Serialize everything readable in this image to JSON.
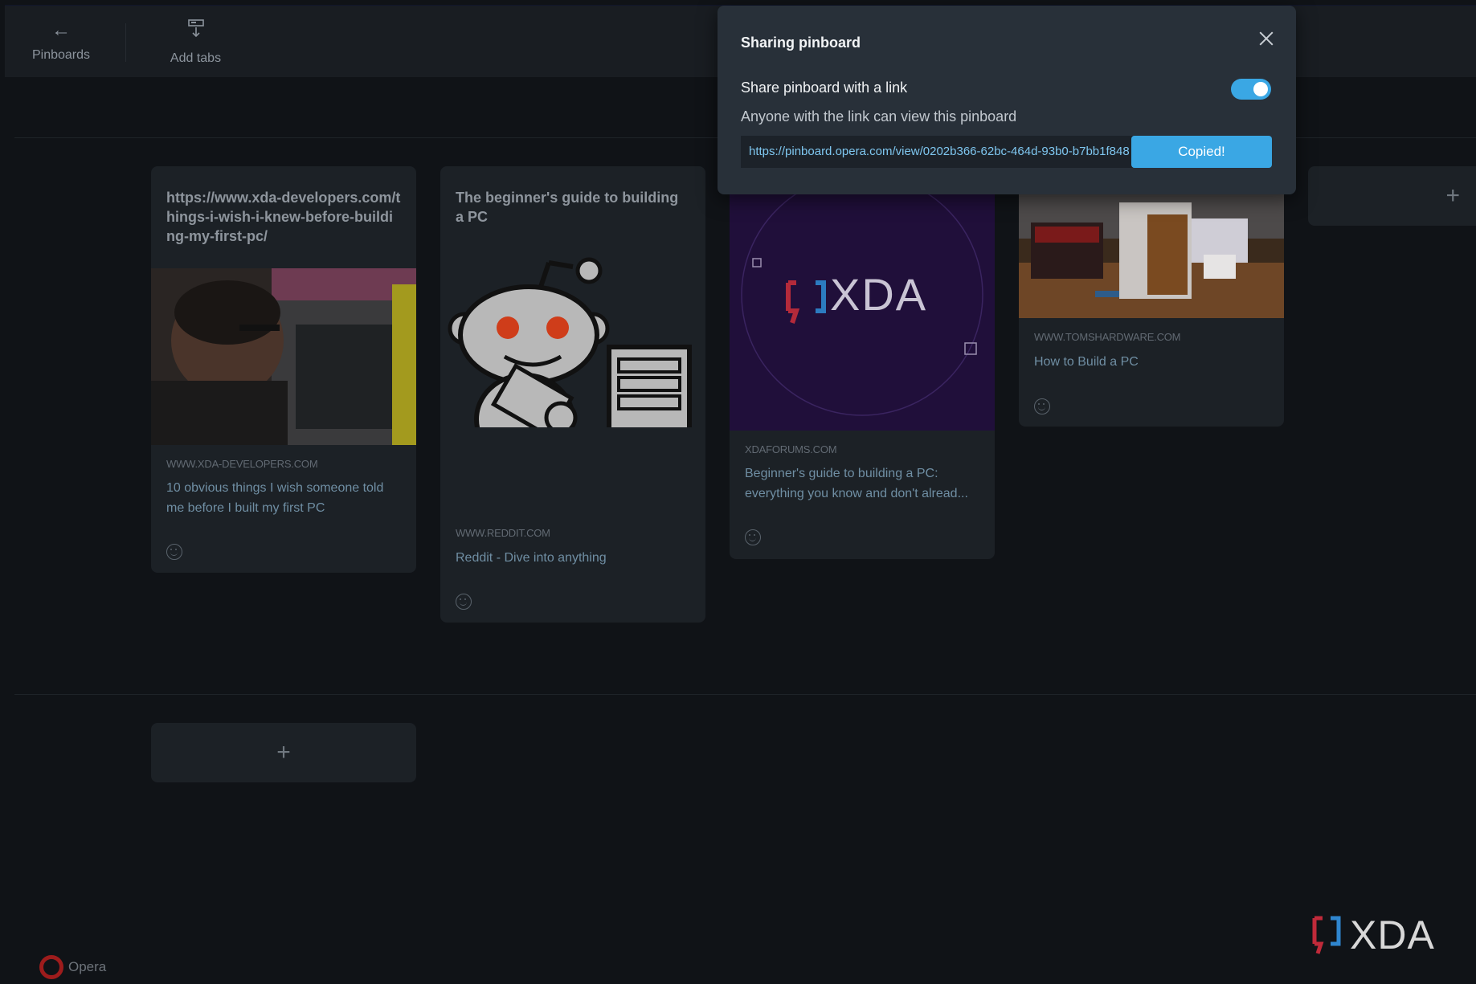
{
  "toolbar": {
    "pinboards_label": "Pinboards",
    "add_tabs_label": "Add tabs"
  },
  "cards": [
    {
      "title": "https://www.xda-developers.com/things-i-wish-i-knew-before-building-my-first-pc/",
      "domain": "WWW.XDA-DEVELOPERS.COM",
      "description": "10 obvious things I wish someone told me before I built my first PC"
    },
    {
      "title": "The beginner's guide to building a PC",
      "domain": "WWW.REDDIT.COM",
      "description": "Reddit - Dive into anything"
    },
    {
      "image_text": "XDA",
      "domain": "XDAFORUMS.COM",
      "description": "Beginner's guide to building a PC: everything you know and don't alread..."
    },
    {
      "domain": "WWW.TOMSHARDWARE.COM",
      "description": "How to Build a PC"
    }
  ],
  "modal": {
    "title": "Sharing pinboard",
    "share_label": "Share pinboard with a link",
    "share_enabled": true,
    "hint": "Anyone with the link can view this pinboard",
    "link": "https://pinboard.opera.com/view/0202b366-62bc-464d-93b0-b7bb1f848",
    "copy_label": "Copied!"
  },
  "branding": {
    "browser": "Opera",
    "watermark": "XDA"
  },
  "colors": {
    "accent": "#3aa7e4",
    "background": "#101317",
    "card": "#1c2126",
    "modal": "#283039"
  }
}
